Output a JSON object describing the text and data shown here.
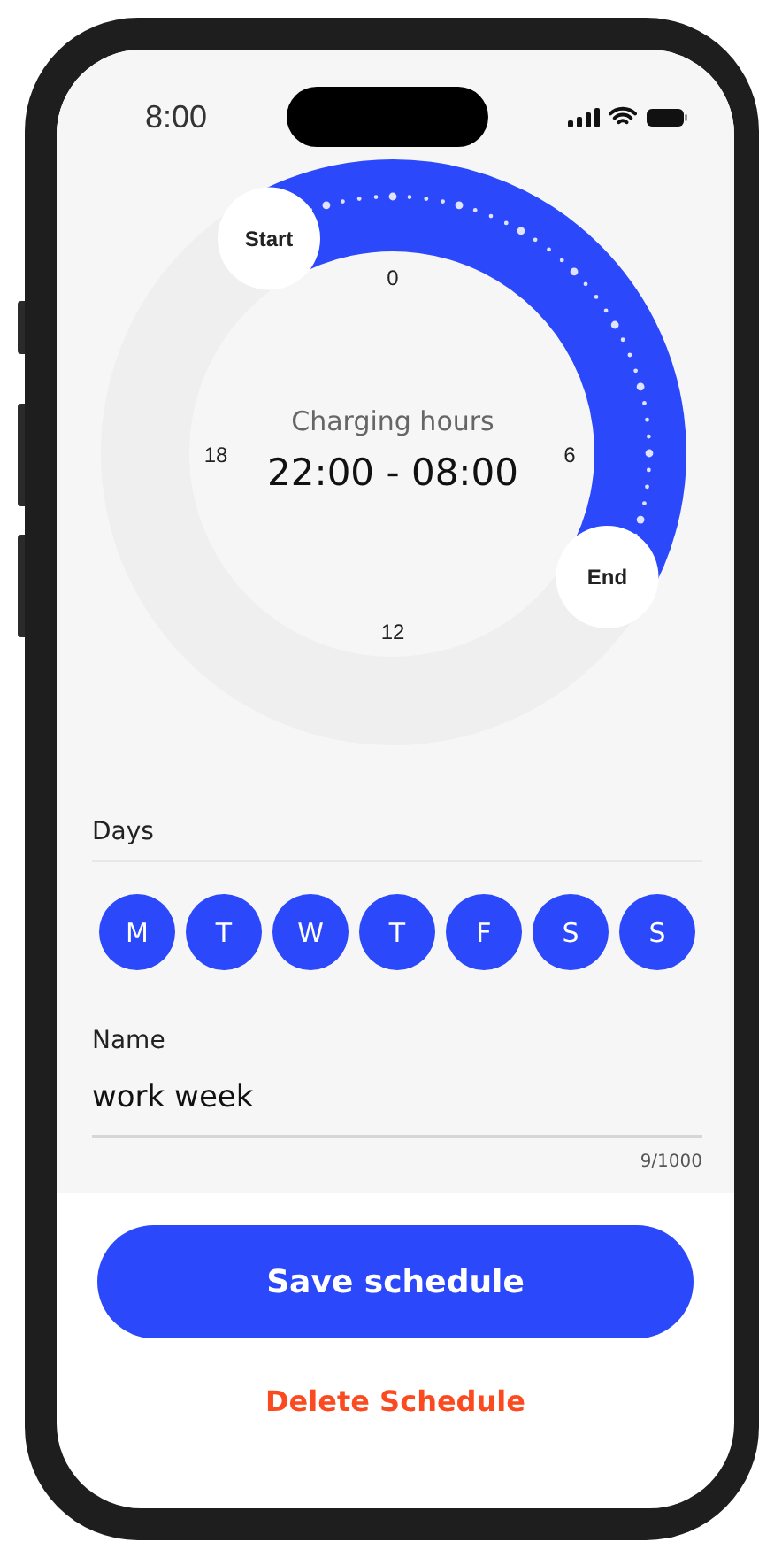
{
  "status_bar": {
    "time": "8:00"
  },
  "dial": {
    "labels": [
      "0",
      "6",
      "12",
      "18"
    ],
    "start_label": "Start",
    "end_label": "End",
    "caption": "Charging hours",
    "time_range": "22:00 - 08:00"
  },
  "days": {
    "title": "Days",
    "items": [
      {
        "label": "M",
        "selected": true
      },
      {
        "label": "T",
        "selected": true
      },
      {
        "label": "W",
        "selected": true
      },
      {
        "label": "T",
        "selected": true
      },
      {
        "label": "F",
        "selected": true
      },
      {
        "label": "S",
        "selected": true
      },
      {
        "label": "S",
        "selected": true
      }
    ]
  },
  "name_field": {
    "label": "Name",
    "value": "work week",
    "counter": "9/1000"
  },
  "buttons": {
    "save": "Save schedule",
    "delete": "Delete Schedule"
  }
}
